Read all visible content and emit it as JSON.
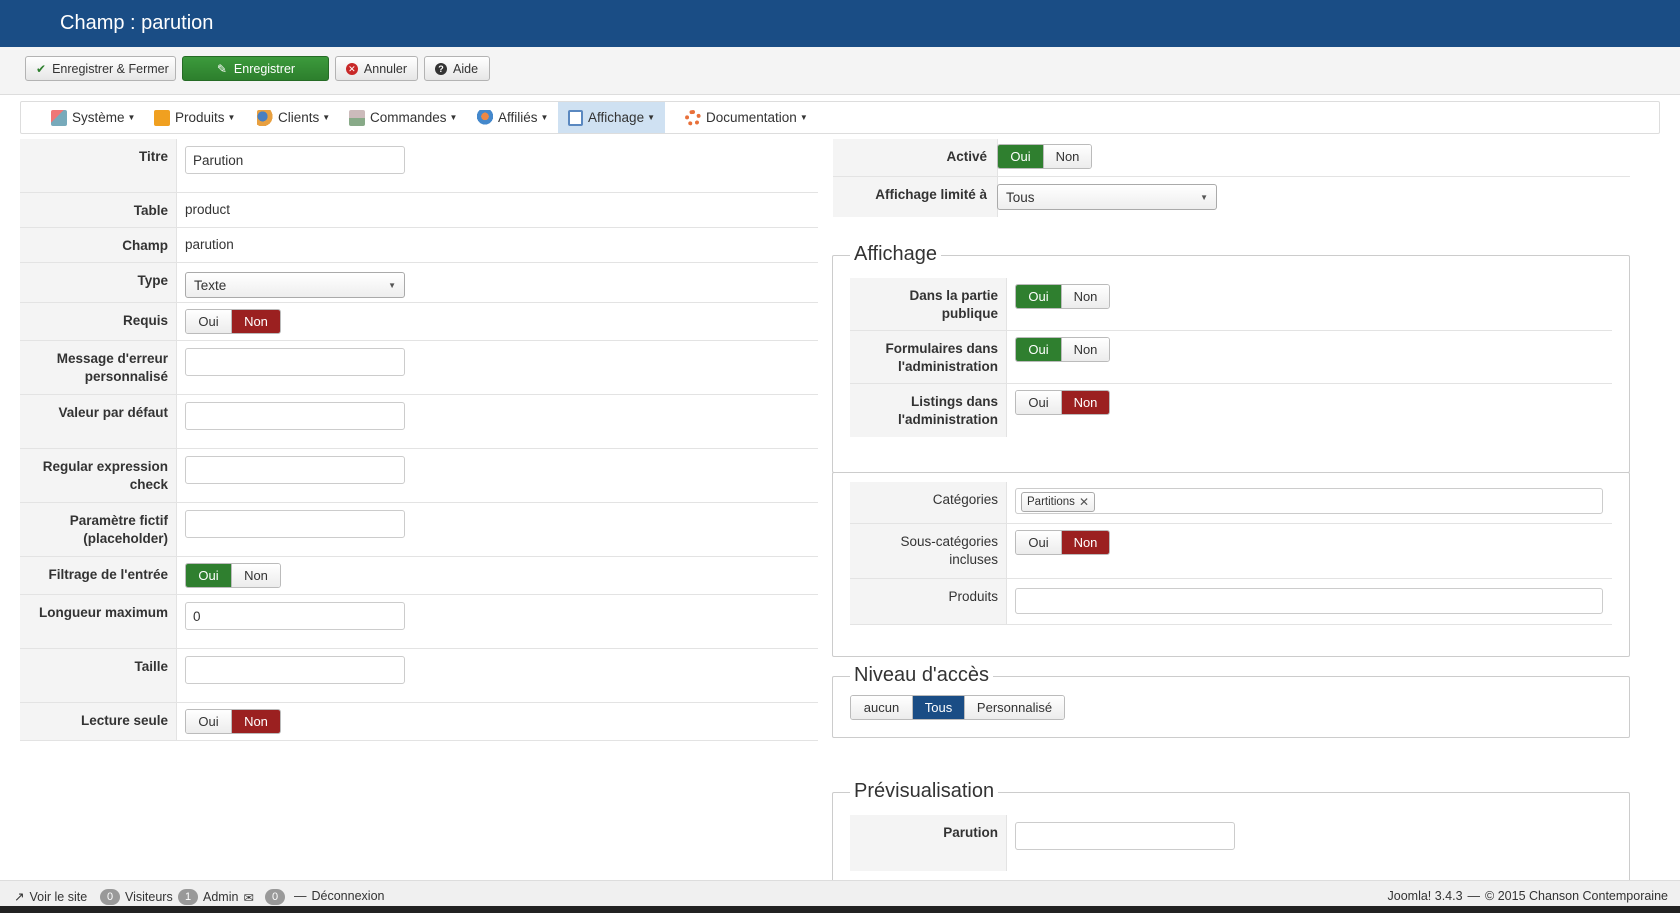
{
  "header": {
    "title": "Champ : parution"
  },
  "toolbar": {
    "save_close": "Enregistrer & Fermer",
    "save": "Enregistrer",
    "cancel": "Annuler",
    "help": "Aide"
  },
  "menu": {
    "items": [
      {
        "label": "Système",
        "icon": "tools-icon"
      },
      {
        "label": "Produits",
        "icon": "box-icon"
      },
      {
        "label": "Clients",
        "icon": "users-icon"
      },
      {
        "label": "Commandes",
        "icon": "cart-icon"
      },
      {
        "label": "Affiliés",
        "icon": "affiliate-icon"
      },
      {
        "label": "Affichage",
        "icon": "display-icon",
        "active": true
      },
      {
        "label": "Documentation",
        "icon": "help-ring-icon"
      }
    ]
  },
  "left": {
    "titre": {
      "label": "Titre",
      "value": "Parution"
    },
    "table": {
      "label": "Table",
      "value": "product"
    },
    "champ": {
      "label": "Champ",
      "value": "parution"
    },
    "type": {
      "label": "Type",
      "value": "Texte"
    },
    "requis": {
      "label": "Requis",
      "yes": "Oui",
      "no": "Non",
      "selected": "Non"
    },
    "message": {
      "label": "Message d'erreur personnalisé",
      "value": ""
    },
    "defaut": {
      "label": "Valeur par défaut",
      "value": ""
    },
    "regex": {
      "label": "Regular expression check",
      "value": ""
    },
    "placeholder": {
      "label": "Paramètre fictif (placeholder)",
      "value": ""
    },
    "filtrage": {
      "label": "Filtrage de l'entrée",
      "yes": "Oui",
      "no": "Non",
      "selected": "Oui"
    },
    "longueur": {
      "label": "Longueur maximum",
      "value": "0"
    },
    "taille": {
      "label": "Taille",
      "value": ""
    },
    "lecture": {
      "label": "Lecture seule",
      "yes": "Oui",
      "no": "Non",
      "selected": "Non"
    }
  },
  "right": {
    "active": {
      "label": "Activé",
      "yes": "Oui",
      "no": "Non",
      "selected": "Oui"
    },
    "limit": {
      "label": "Affichage limité à",
      "value": "Tous"
    },
    "affichage": {
      "legend": "Affichage",
      "public": {
        "label": "Dans la partie publique",
        "yes": "Oui",
        "no": "Non",
        "selected": "Oui"
      },
      "forms": {
        "label": "Formulaires dans l'administration",
        "yes": "Oui",
        "no": "Non",
        "selected": "Oui"
      },
      "listings": {
        "label": "Listings dans l'administration",
        "yes": "Oui",
        "no": "Non",
        "selected": "Non"
      }
    },
    "categories": {
      "label": "Catégories",
      "chips": [
        "Partitions"
      ],
      "sub": {
        "label": "Sous-catégories incluses",
        "yes": "Oui",
        "no": "Non",
        "selected": "Non"
      },
      "products": {
        "label": "Produits",
        "value": ""
      }
    },
    "access": {
      "legend": "Niveau d'accès",
      "options": [
        "aucun",
        "Tous",
        "Personnalisé"
      ],
      "selected": "Tous"
    },
    "preview": {
      "legend": "Prévisualisation",
      "field": {
        "label": "Parution",
        "value": ""
      }
    }
  },
  "footer": {
    "view_site": "Voir le site",
    "visitors_count": "0",
    "visitors": "Visiteurs",
    "admin_count": "1",
    "admin": "Admin",
    "messages_count": "0",
    "logout": "Déconnexion",
    "version": "Joomla! 3.4.3",
    "sep": "—",
    "copyright": "© 2015 Chanson Contemporaine"
  },
  "colors": {
    "header_bg": "#1a4d85",
    "success": "#2f7f2f",
    "danger": "#9b2020",
    "active_menu": "#cfe1f2"
  }
}
